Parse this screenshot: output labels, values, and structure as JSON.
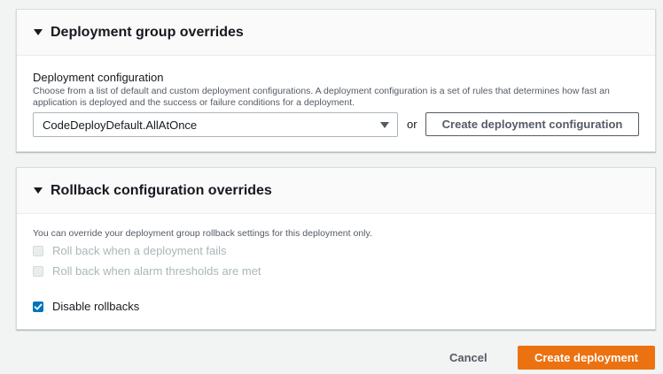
{
  "deployment_group_overrides": {
    "title": "Deployment group overrides",
    "field_label": "Deployment configuration",
    "field_description": "Choose from a list of default and custom deployment configurations. A deployment configuration is a set of rules that determines how fast an application is deployed and the success or failure conditions for a deployment.",
    "select_value": "CodeDeployDefault.AllAtOnce",
    "or_text": "or",
    "create_config_label": "Create deployment configuration"
  },
  "rollback_overrides": {
    "title": "Rollback configuration overrides",
    "description": "You can override your deployment group rollback settings for this deployment only.",
    "options": [
      {
        "label": "Roll back when a deployment fails",
        "checked": false,
        "disabled": true
      },
      {
        "label": "Roll back when alarm thresholds are met",
        "checked": false,
        "disabled": true
      },
      {
        "label": "Disable rollbacks",
        "checked": true,
        "disabled": false
      }
    ]
  },
  "footer": {
    "cancel_label": "Cancel",
    "submit_label": "Create deployment"
  },
  "colors": {
    "primary_button": "#ec7211",
    "checkbox_checked": "#0073bb",
    "page_background": "#f2f3f3"
  },
  "icons": {
    "collapse": "caret-down-icon",
    "select": "chevron-down-icon",
    "check": "checkmark-icon"
  }
}
